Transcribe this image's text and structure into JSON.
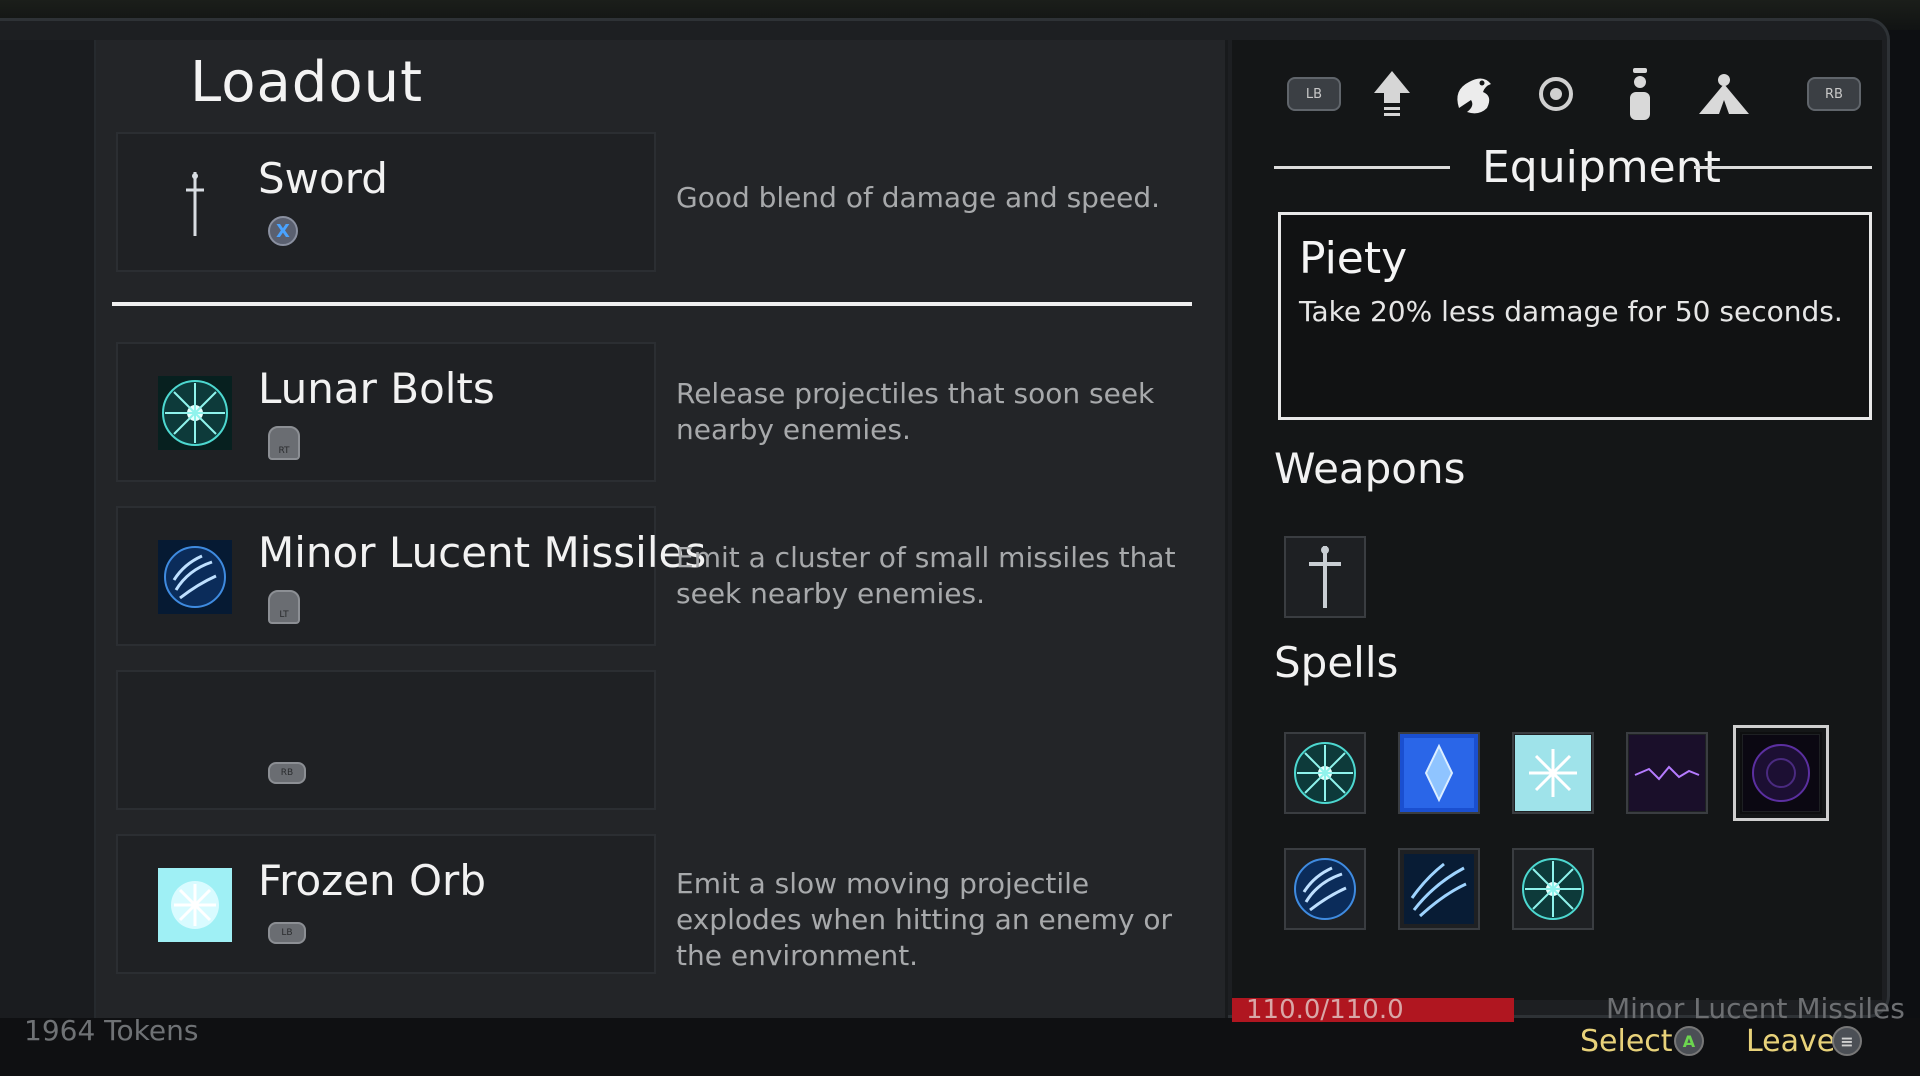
{
  "loadout": {
    "title": "Loadout",
    "slots": [
      {
        "name": "Sword",
        "button": "X",
        "description": "Good blend of damage and speed.",
        "icon": "sword-icon"
      },
      {
        "name": "Lunar Bolts",
        "button": "RT",
        "description": "Release projectiles that soon seek nearby enemies.",
        "icon": "lunar-bolts-icon"
      },
      {
        "name": "Minor Lucent Missiles",
        "button": "LT",
        "description": "Emit a cluster of small missiles that seek nearby enemies.",
        "icon": "lucent-missiles-icon"
      },
      {
        "name": "",
        "button": "RB",
        "description": "",
        "icon": ""
      },
      {
        "name": "Frozen Orb",
        "button": "LB",
        "description": "Emit a slow moving projectile explodes when hitting an enemy or the environment.",
        "icon": "frozen-orb-icon"
      }
    ]
  },
  "tabs": {
    "left_bumper": "LB",
    "right_bumper": "RB",
    "icons": [
      "upgrade-arrow-icon",
      "dragon-icon",
      "ring-icon",
      "potion-icon",
      "map-icon"
    ]
  },
  "equipment": {
    "title": "Equipment",
    "tooltip": {
      "name": "Piety",
      "description": "Take 20% less damage for 50 seconds."
    },
    "weapons_title": "Weapons",
    "spells_title": "Spells"
  },
  "footer": {
    "tokens": "1964 Tokens",
    "hp": "110.0/110.0",
    "behind_text": "Minor Lucent Missiles",
    "select_label": "Select",
    "select_button": "A",
    "leave_label": "Leave",
    "leave_button": "≡"
  },
  "colors": {
    "hp": "#b01620",
    "prompt": "#e8d27a",
    "accent_x": "#4aa3ff"
  }
}
